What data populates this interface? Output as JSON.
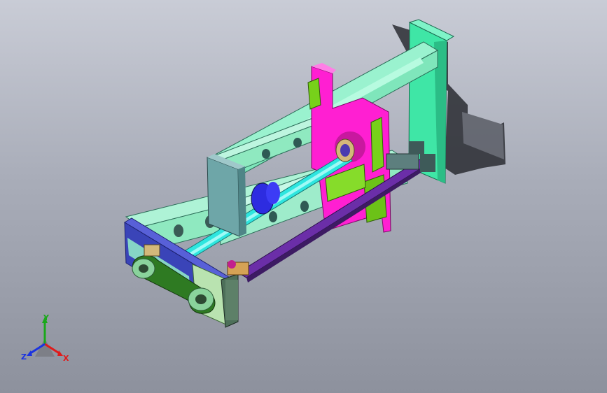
{
  "viewport": {
    "background_top": "#c9ccd6",
    "background_bottom": "#8d919d"
  },
  "model": {
    "parts": [
      {
        "name": "rear-end-plate",
        "color": "#3fe6a6"
      },
      {
        "name": "frame-rails",
        "color": "#8ff0c8"
      },
      {
        "name": "carriage-plate",
        "color": "#ff1fd2"
      },
      {
        "name": "bracket-green",
        "color": "#77d11a"
      },
      {
        "name": "ball-screw-shaft",
        "color": "#2ee6df"
      },
      {
        "name": "screw-nut",
        "color": "#2d2ce0"
      },
      {
        "name": "front-motor-plate",
        "color": "#3a44b8"
      },
      {
        "name": "front-support-block",
        "color": "#6ea6a8"
      },
      {
        "name": "timing-belt",
        "color": "#2e7a22"
      },
      {
        "name": "pulley",
        "color": "#8ad39c"
      }
    ]
  },
  "triad": {
    "y_label": "Y",
    "z_label": "Z",
    "x_label": "X",
    "y_color": "#1aa81a",
    "x_color": "#e01b1b",
    "z_color": "#1b33e0"
  }
}
